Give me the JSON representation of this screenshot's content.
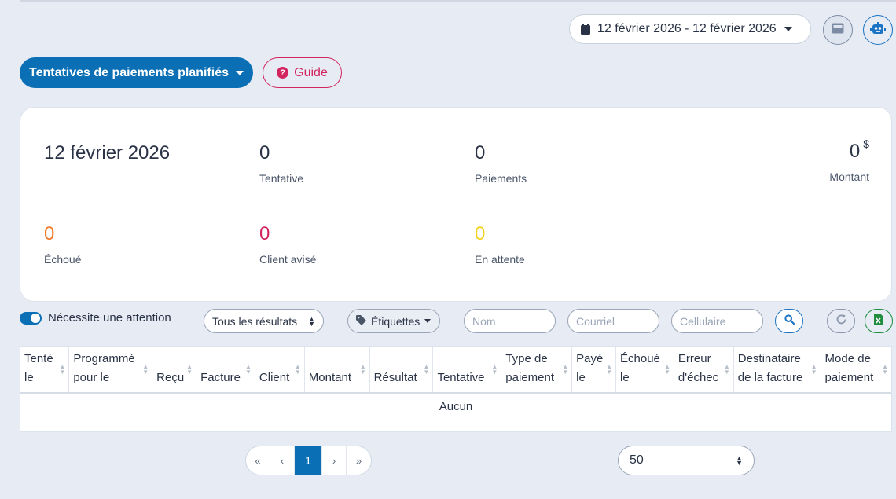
{
  "header": {
    "date_range": "12 février 2026 - 12 février 2026",
    "icons": [
      "calendar-icon",
      "card-icon",
      "robot-icon"
    ]
  },
  "actions": {
    "primary_label": "Tentatives de paiements planifiés",
    "guide_label": "Guide"
  },
  "stats": {
    "date": "12 février 2026",
    "tentative": {
      "value": "0",
      "label": "Tentative"
    },
    "paiements": {
      "value": "0",
      "label": "Paiements"
    },
    "montant": {
      "value": "0",
      "currency": "$",
      "label": "Montant"
    },
    "echoue": {
      "value": "0",
      "label": "Échoué",
      "color": "#f07a2a"
    },
    "client_avise": {
      "value": "0",
      "label": "Client avisé",
      "color": "#d2245e"
    },
    "en_attente": {
      "value": "0",
      "label": "En attente",
      "color": "#f4d21c"
    }
  },
  "filters": {
    "attention_label": "Nécessite une attention",
    "attention_on": true,
    "results_select": "Tous les résultats",
    "tags_label": "Étiquettes",
    "nom_placeholder": "Nom",
    "courriel_placeholder": "Courriel",
    "cellulaire_placeholder": "Cellulaire"
  },
  "table": {
    "columns": [
      [
        "Tenté",
        "le"
      ],
      [
        "Programmé",
        "pour le"
      ],
      [
        "Reçu"
      ],
      [
        "Facture"
      ],
      [
        "Client"
      ],
      [
        "Montant"
      ],
      [
        "Résultat"
      ],
      [
        "Tentative"
      ],
      [
        "Type de",
        "paiement"
      ],
      [
        "Payé",
        "le"
      ],
      [
        "Échoué",
        "le"
      ],
      [
        "Erreur",
        "d'échec"
      ],
      [
        "Destinataire",
        "de la facture"
      ],
      [
        "Mode de",
        "paiement"
      ]
    ],
    "empty_text": "Aucun"
  },
  "pagination": {
    "first": "«",
    "prev": "‹",
    "current": "1",
    "next": "›",
    "last": "»",
    "per_page": "50"
  },
  "colors": {
    "primary": "#0a6fb5",
    "guide": "#d2245e",
    "background": "#e6ebf4"
  }
}
